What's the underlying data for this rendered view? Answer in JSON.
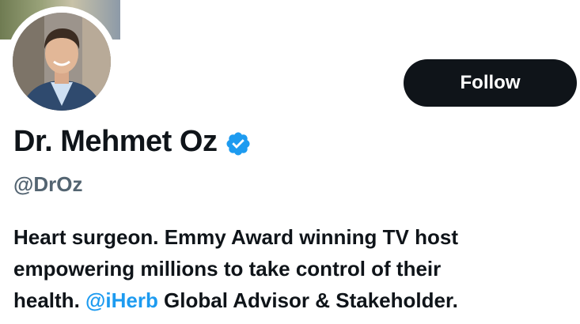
{
  "profile": {
    "display_name": "Dr. Mehmet Oz",
    "handle": "@DrOz",
    "verified": true,
    "bio": {
      "line1": "Heart surgeon. Emmy Award winning TV host",
      "line2": "empowering millions to take control of their",
      "line3_prefix": "health. ",
      "mention": "@iHerb",
      "line3_suffix": " Global Advisor & Stakeholder."
    }
  },
  "actions": {
    "follow_label": "Follow"
  },
  "colors": {
    "accent": "#1d9bf0",
    "text_primary": "#0f1419",
    "text_secondary": "#536471",
    "button_bg": "#0f1419"
  }
}
